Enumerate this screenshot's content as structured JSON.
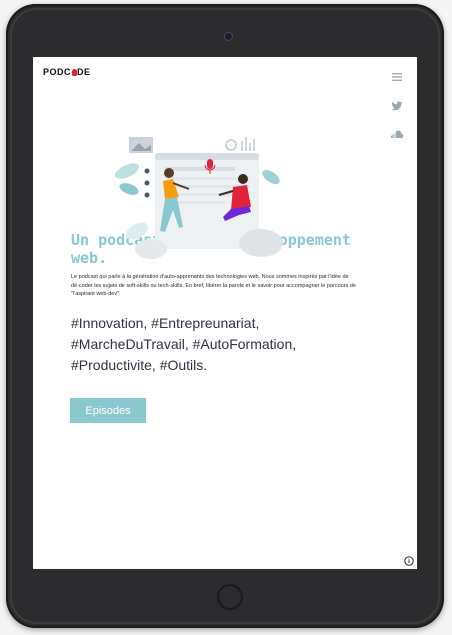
{
  "brand": {
    "logo_left": "PODC",
    "logo_right": "DE",
    "accent": "#8ac7cf",
    "mic_color": "#e0253a"
  },
  "side_nav": {
    "icons": [
      "menu-icon",
      "twitter-icon",
      "soundcloud-icon"
    ]
  },
  "hero": {
    "title": "Un podcast sur le développement web.",
    "description": "Le podcast qui parle à la génération d'auto-apprenants des technologies web. Nous sommes inspirés par l'idée de dé-coder les sujets de soft-skills ou tech-skills. En bref, libérer la parole et le savoir pour accompagner le parcours de \"l'aspirant web-dev\".",
    "tags": "#Innovation, #Entrepreunariat, #MarcheDuTravail, #AutoFormation, #Productivite, #Outils.",
    "cta_label": "Episodes"
  },
  "footer": {
    "info_icon": "info-icon"
  }
}
